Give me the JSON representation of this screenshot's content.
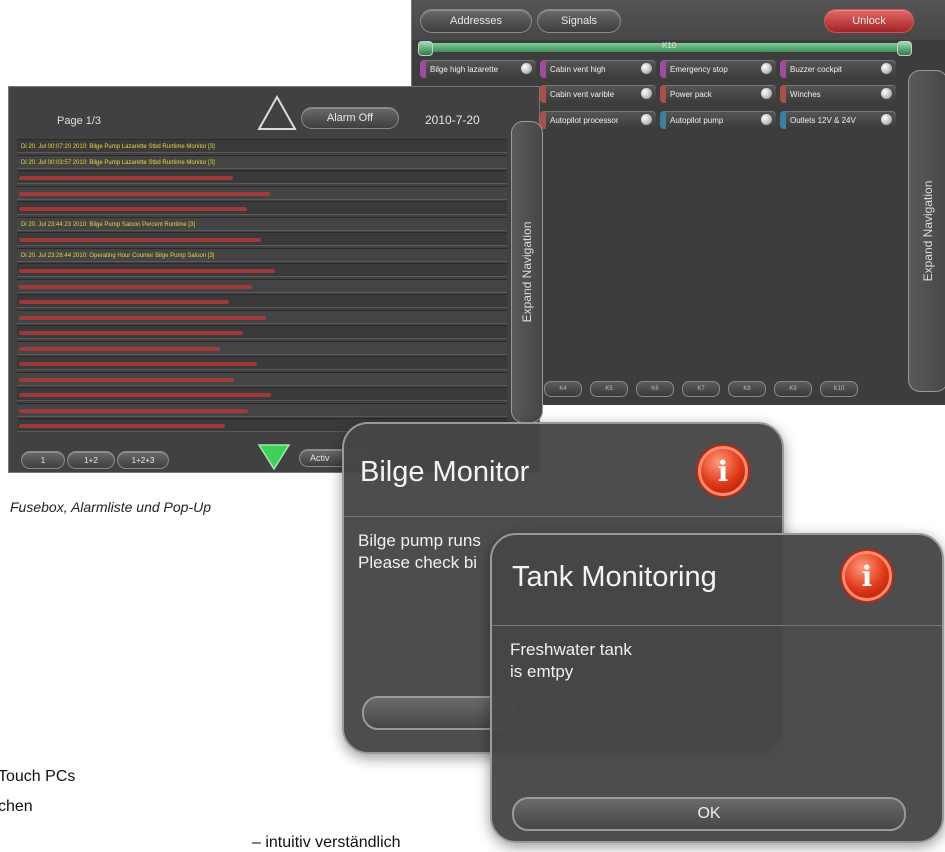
{
  "fusebox": {
    "buttons": {
      "addresses": "Addresses",
      "signals": "Signals",
      "unlock": "Unlock"
    },
    "slider_label": "K10",
    "fuses": [
      {
        "label": "Bilge high lazarette",
        "color": "#9b4c9b"
      },
      {
        "label": "Cabin vent high",
        "color": "#9b4c9b"
      },
      {
        "label": "Emergency stop",
        "color": "#9b4c9b"
      },
      {
        "label": "Buzzer cockpit",
        "color": "#9b4c9b"
      },
      {
        "label": "Cabin vent varible",
        "color": "#a8504a"
      },
      {
        "label": "Power pack",
        "color": "#a8504a"
      },
      {
        "label": "Winches",
        "color": "#a8504a"
      },
      {
        "label": "Autopilot processor",
        "color": "#a8504a"
      },
      {
        "label": "Autopilot pump",
        "color": "#3e7fa0"
      },
      {
        "label": "Outlets 12V & 24V",
        "color": "#3e7fa0"
      }
    ],
    "nav_buttons": [
      "K4",
      "K5",
      "K6",
      "K7",
      "K8",
      "K9",
      "K10"
    ],
    "expand_nav_label": "Expand Navigation"
  },
  "alarm_list": {
    "page_label": "Page 1/3",
    "alarm_off_label": "Alarm Off",
    "date": "2010-7-20",
    "rows": [
      {
        "text": "Di 20. Jul 00:07:20 2010: Bilge Pump Lazarette Stbd Runtime Monitor [3]",
        "level": "y"
      },
      {
        "text": "Di 20. Jul 00:03:57 2010: Bilge Pump Lazarette Stbd Runtime Monitor [3]",
        "level": "y"
      },
      {
        "text": "",
        "level": "r"
      },
      {
        "text": "",
        "level": "r"
      },
      {
        "text": "",
        "level": "r"
      },
      {
        "text": "Di 20. Jul 23:44:23 2010: Bilge Pump Saloon Percent Runtime [3]",
        "level": "y"
      },
      {
        "text": "",
        "level": "r"
      },
      {
        "text": "Di 20. Jul 23:26:44 2010: Operating Hour Counter Bilge Pump Saloon [3]",
        "level": "y"
      },
      {
        "text": "",
        "level": "r"
      },
      {
        "text": "",
        "level": "r"
      },
      {
        "text": "",
        "level": "r"
      },
      {
        "text": "",
        "level": "r"
      },
      {
        "text": "",
        "level": "r"
      },
      {
        "text": "",
        "level": "r"
      },
      {
        "text": "",
        "level": "r"
      },
      {
        "text": "",
        "level": "r"
      },
      {
        "text": "",
        "level": "r"
      },
      {
        "text": "",
        "level": "r"
      },
      {
        "text": "",
        "level": "r"
      }
    ],
    "page_buttons": [
      "1",
      "1+2",
      "1+2+3"
    ],
    "active_label": "Activ",
    "expand_nav_label": "Expand Navigation"
  },
  "caption": "Fusebox, Alarmliste und Pop-Up",
  "bilge_popup": {
    "title": "Bilge Monitor",
    "message": "Bilge pump runs\nPlease check bi"
  },
  "tank_popup": {
    "title": "Tank Monitoring",
    "message": "Freshwater tank\nis emtpy",
    "ok_label": "OK"
  },
  "bottom_text": [
    "Touch PCs",
    "chen",
    "– intuitiv verständlich"
  ]
}
